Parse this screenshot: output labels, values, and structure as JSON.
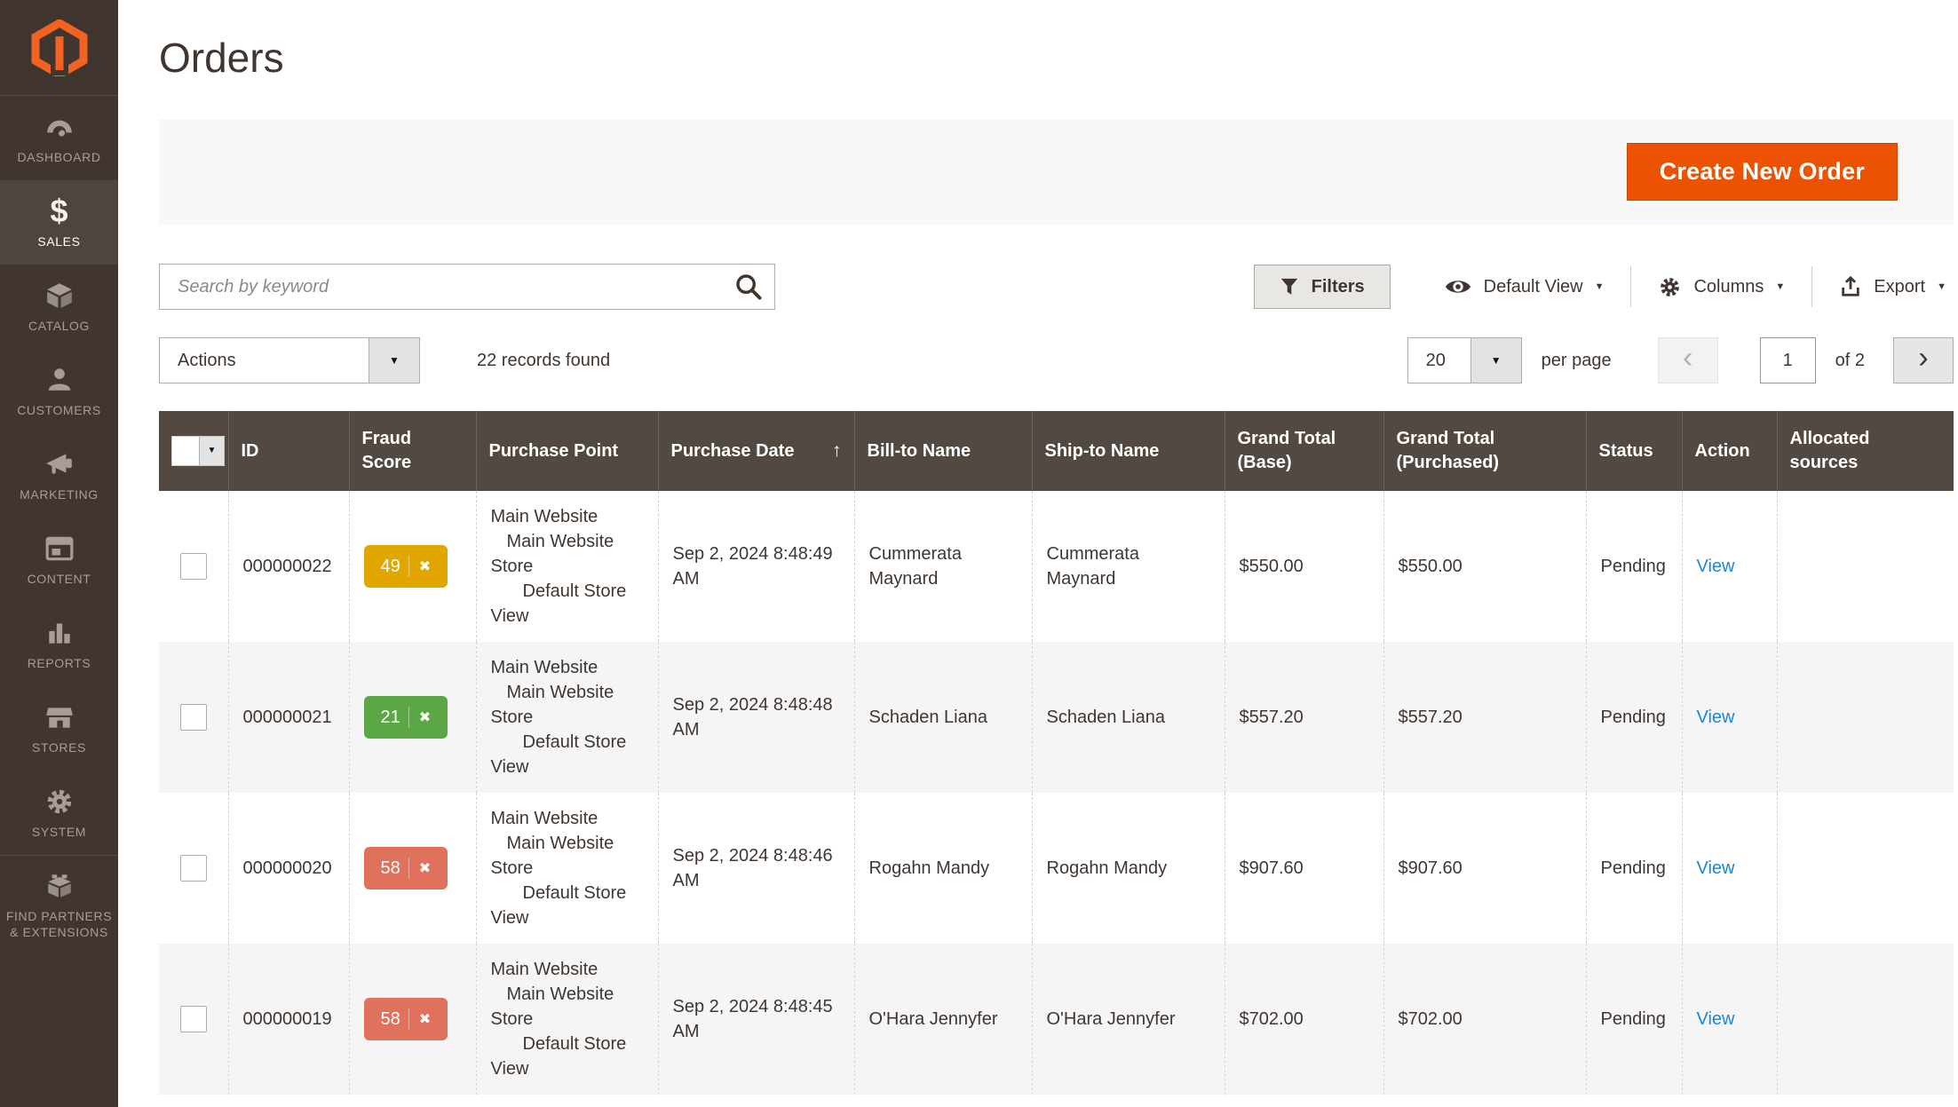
{
  "page_title": "Orders",
  "colors": {
    "accent_orange": "#eb5202",
    "logo_orange": "#f26322",
    "sidebar_bg": "#41362f",
    "table_header_bg": "#524a42",
    "link_blue": "#1787e0",
    "fraud_yellow": "#e2a600",
    "fraud_green": "#5ba745",
    "fraud_red": "#e0715c"
  },
  "icons": {
    "caret_down": "▼",
    "sort_asc": "↑",
    "close_x": "✖",
    "chevron_left": "‹",
    "chevron_right": "›",
    "dollar": "$"
  },
  "sidebar": {
    "items": [
      {
        "label": "Dashboard"
      },
      {
        "label": "Sales"
      },
      {
        "label": "Catalog"
      },
      {
        "label": "Customers"
      },
      {
        "label": "Marketing"
      },
      {
        "label": "Content"
      },
      {
        "label": "Reports"
      },
      {
        "label": "Stores"
      },
      {
        "label": "System"
      },
      {
        "label": "Find Partners & Extensions"
      }
    ]
  },
  "header": {
    "create_order_button": "Create New Order"
  },
  "toolbar": {
    "search_placeholder": "Search by keyword",
    "filters_label": "Filters",
    "view_label": "Default View",
    "columns_label": "Columns",
    "export_label": "Export"
  },
  "controls": {
    "actions_label": "Actions",
    "records_text": "22 records found",
    "per_page_value": "20",
    "per_page_label": "per page",
    "page_value": "1",
    "page_of": "of 2"
  },
  "table": {
    "columns": {
      "id": "ID",
      "fraud_score": "Fraud Score",
      "purchase_point": "Purchase Point",
      "purchase_date": "Purchase Date",
      "bill_to": "Bill-to Name",
      "ship_to": "Ship-to Name",
      "grand_total_base": "Grand Total (Base)",
      "grand_total_purchased": "Grand Total (Purchased)",
      "status": "Status",
      "action": "Action",
      "allocated_sources": "Allocated sources"
    },
    "rows": [
      {
        "id": "000000022",
        "fraud_score": "49",
        "fraud_color": "#e2a600",
        "purchase_point": [
          "Main Website",
          "Main Website Store",
          "Default Store View"
        ],
        "purchase_date": "Sep 2, 2024 8:48:49 AM",
        "bill_to": "Cummerata Maynard",
        "ship_to": "Cummerata Maynard",
        "grand_total_base": "$550.00",
        "grand_total_purchased": "$550.00",
        "status": "Pending",
        "action": "View",
        "allocated_sources": ""
      },
      {
        "id": "000000021",
        "fraud_score": "21",
        "fraud_color": "#5ba745",
        "purchase_point": [
          "Main Website",
          "Main Website Store",
          "Default Store View"
        ],
        "purchase_date": "Sep 2, 2024 8:48:48 AM",
        "bill_to": "Schaden Liana",
        "ship_to": "Schaden Liana",
        "grand_total_base": "$557.20",
        "grand_total_purchased": "$557.20",
        "status": "Pending",
        "action": "View",
        "allocated_sources": ""
      },
      {
        "id": "000000020",
        "fraud_score": "58",
        "fraud_color": "#e0715c",
        "purchase_point": [
          "Main Website",
          "Main Website Store",
          "Default Store View"
        ],
        "purchase_date": "Sep 2, 2024 8:48:46 AM",
        "bill_to": "Rogahn Mandy",
        "ship_to": "Rogahn Mandy",
        "grand_total_base": "$907.60",
        "grand_total_purchased": "$907.60",
        "status": "Pending",
        "action": "View",
        "allocated_sources": ""
      },
      {
        "id": "000000019",
        "fraud_score": "58",
        "fraud_color": "#e0715c",
        "purchase_point": [
          "Main Website",
          "Main Website Store",
          "Default Store View"
        ],
        "purchase_date": "Sep 2, 2024 8:48:45 AM",
        "bill_to": "O'Hara Jennyfer",
        "ship_to": "O'Hara Jennyfer",
        "grand_total_base": "$702.00",
        "grand_total_purchased": "$702.00",
        "status": "Pending",
        "action": "View",
        "allocated_sources": ""
      }
    ]
  }
}
